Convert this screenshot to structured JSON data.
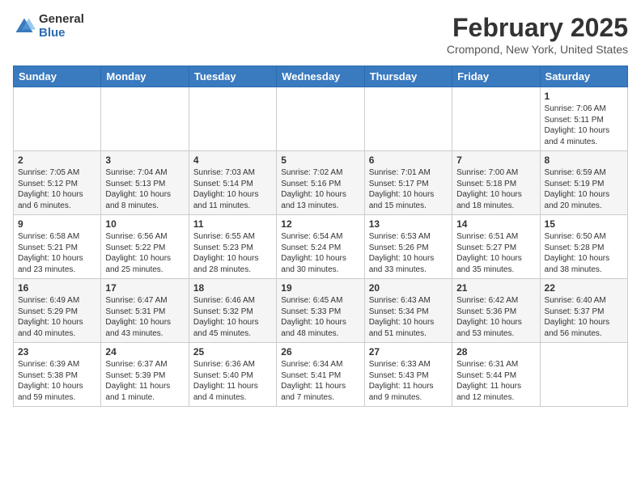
{
  "header": {
    "logo_line1": "General",
    "logo_line2": "Blue",
    "month": "February 2025",
    "location": "Crompond, New York, United States"
  },
  "weekdays": [
    "Sunday",
    "Monday",
    "Tuesday",
    "Wednesday",
    "Thursday",
    "Friday",
    "Saturday"
  ],
  "weeks": [
    [
      {
        "day": "",
        "info": ""
      },
      {
        "day": "",
        "info": ""
      },
      {
        "day": "",
        "info": ""
      },
      {
        "day": "",
        "info": ""
      },
      {
        "day": "",
        "info": ""
      },
      {
        "day": "",
        "info": ""
      },
      {
        "day": "1",
        "info": "Sunrise: 7:06 AM\nSunset: 5:11 PM\nDaylight: 10 hours and 4 minutes."
      }
    ],
    [
      {
        "day": "2",
        "info": "Sunrise: 7:05 AM\nSunset: 5:12 PM\nDaylight: 10 hours and 6 minutes."
      },
      {
        "day": "3",
        "info": "Sunrise: 7:04 AM\nSunset: 5:13 PM\nDaylight: 10 hours and 8 minutes."
      },
      {
        "day": "4",
        "info": "Sunrise: 7:03 AM\nSunset: 5:14 PM\nDaylight: 10 hours and 11 minutes."
      },
      {
        "day": "5",
        "info": "Sunrise: 7:02 AM\nSunset: 5:16 PM\nDaylight: 10 hours and 13 minutes."
      },
      {
        "day": "6",
        "info": "Sunrise: 7:01 AM\nSunset: 5:17 PM\nDaylight: 10 hours and 15 minutes."
      },
      {
        "day": "7",
        "info": "Sunrise: 7:00 AM\nSunset: 5:18 PM\nDaylight: 10 hours and 18 minutes."
      },
      {
        "day": "8",
        "info": "Sunrise: 6:59 AM\nSunset: 5:19 PM\nDaylight: 10 hours and 20 minutes."
      }
    ],
    [
      {
        "day": "9",
        "info": "Sunrise: 6:58 AM\nSunset: 5:21 PM\nDaylight: 10 hours and 23 minutes."
      },
      {
        "day": "10",
        "info": "Sunrise: 6:56 AM\nSunset: 5:22 PM\nDaylight: 10 hours and 25 minutes."
      },
      {
        "day": "11",
        "info": "Sunrise: 6:55 AM\nSunset: 5:23 PM\nDaylight: 10 hours and 28 minutes."
      },
      {
        "day": "12",
        "info": "Sunrise: 6:54 AM\nSunset: 5:24 PM\nDaylight: 10 hours and 30 minutes."
      },
      {
        "day": "13",
        "info": "Sunrise: 6:53 AM\nSunset: 5:26 PM\nDaylight: 10 hours and 33 minutes."
      },
      {
        "day": "14",
        "info": "Sunrise: 6:51 AM\nSunset: 5:27 PM\nDaylight: 10 hours and 35 minutes."
      },
      {
        "day": "15",
        "info": "Sunrise: 6:50 AM\nSunset: 5:28 PM\nDaylight: 10 hours and 38 minutes."
      }
    ],
    [
      {
        "day": "16",
        "info": "Sunrise: 6:49 AM\nSunset: 5:29 PM\nDaylight: 10 hours and 40 minutes."
      },
      {
        "day": "17",
        "info": "Sunrise: 6:47 AM\nSunset: 5:31 PM\nDaylight: 10 hours and 43 minutes."
      },
      {
        "day": "18",
        "info": "Sunrise: 6:46 AM\nSunset: 5:32 PM\nDaylight: 10 hours and 45 minutes."
      },
      {
        "day": "19",
        "info": "Sunrise: 6:45 AM\nSunset: 5:33 PM\nDaylight: 10 hours and 48 minutes."
      },
      {
        "day": "20",
        "info": "Sunrise: 6:43 AM\nSunset: 5:34 PM\nDaylight: 10 hours and 51 minutes."
      },
      {
        "day": "21",
        "info": "Sunrise: 6:42 AM\nSunset: 5:36 PM\nDaylight: 10 hours and 53 minutes."
      },
      {
        "day": "22",
        "info": "Sunrise: 6:40 AM\nSunset: 5:37 PM\nDaylight: 10 hours and 56 minutes."
      }
    ],
    [
      {
        "day": "23",
        "info": "Sunrise: 6:39 AM\nSunset: 5:38 PM\nDaylight: 10 hours and 59 minutes."
      },
      {
        "day": "24",
        "info": "Sunrise: 6:37 AM\nSunset: 5:39 PM\nDaylight: 11 hours and 1 minute."
      },
      {
        "day": "25",
        "info": "Sunrise: 6:36 AM\nSunset: 5:40 PM\nDaylight: 11 hours and 4 minutes."
      },
      {
        "day": "26",
        "info": "Sunrise: 6:34 AM\nSunset: 5:41 PM\nDaylight: 11 hours and 7 minutes."
      },
      {
        "day": "27",
        "info": "Sunrise: 6:33 AM\nSunset: 5:43 PM\nDaylight: 11 hours and 9 minutes."
      },
      {
        "day": "28",
        "info": "Sunrise: 6:31 AM\nSunset: 5:44 PM\nDaylight: 11 hours and 12 minutes."
      },
      {
        "day": "",
        "info": ""
      }
    ]
  ]
}
